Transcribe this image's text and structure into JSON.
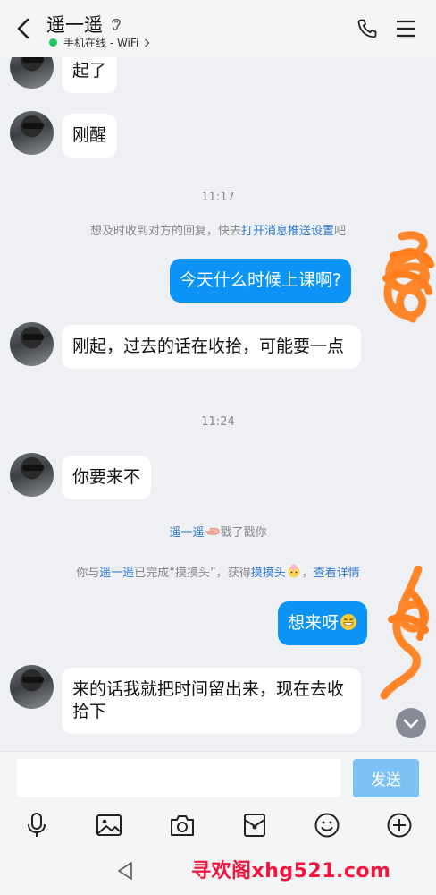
{
  "header": {
    "title": "遥一遥",
    "status": "手机在线 - WiFi",
    "colors": {
      "online": "#21c55d",
      "accent": "#0b93f6"
    }
  },
  "messages": [
    {
      "from": "other",
      "text": "起了"
    },
    {
      "from": "other",
      "text": "刚醒"
    },
    {
      "type": "time",
      "text": "11:17"
    },
    {
      "type": "system",
      "pre": "想及时收到对方的回复，快去",
      "link": "打开消息推送设置",
      "post": "吧"
    },
    {
      "from": "me",
      "text": "今天什么时候上课啊?"
    },
    {
      "from": "other",
      "text": "刚起，过去的话在收拾，可能要一点"
    },
    {
      "type": "time",
      "text": "11:24"
    },
    {
      "from": "other",
      "text": "你要来不"
    },
    {
      "type": "system",
      "link": "遥一遥",
      "post": "戳了戳你",
      "icon": "poke-hand-icon"
    },
    {
      "type": "system",
      "pre": "你与",
      "link": "遥一遥",
      "mid": "已完成“摸摸头”，获得",
      "link2": "摸摸头",
      "post": "，",
      "link3": "查看详情",
      "icon": "pat-head-emoji-icon"
    },
    {
      "from": "me",
      "text": "想来呀",
      "emoji": "grinning-sweat-emoji"
    },
    {
      "from": "other",
      "text": "来的话我就把时间留出来，现在去收拾下"
    }
  ],
  "composer": {
    "input_value": "",
    "send_label": "发送"
  },
  "toolbar": [
    "mic-icon",
    "image-icon",
    "camera-icon",
    "red-packet-icon",
    "emoji-icon",
    "plus-icon"
  ],
  "watermark": "寻欢阁xhg521.com"
}
